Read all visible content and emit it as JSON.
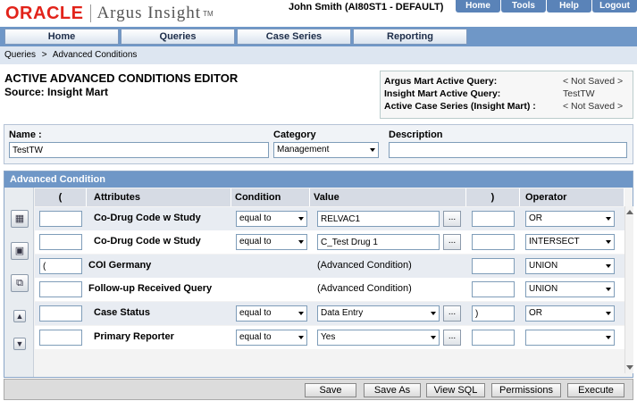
{
  "header": {
    "logo_oracle": "ORACLE",
    "logo_argus": "Argus Insight",
    "logo_tm": "TM",
    "user_info": "John Smith  (AI80ST1 - DEFAULT)",
    "top_links": [
      "Home",
      "Tools",
      "Help",
      "Logout"
    ]
  },
  "main_nav": [
    "Home",
    "Queries",
    "Case Series",
    "Reporting"
  ],
  "breadcrumb": {
    "items": [
      "Queries",
      ">",
      "Advanced Conditions"
    ]
  },
  "page": {
    "title": "ACTIVE ADVANCED CONDITIONS EDITOR",
    "source": "Source: Insight Mart"
  },
  "info": {
    "rows": [
      {
        "key": "Argus Mart Active Query:",
        "value": "< Not Saved >"
      },
      {
        "key": "Insight Mart Active Query:",
        "value": "TestTW"
      },
      {
        "key": "Active Case Series (Insight Mart) :",
        "value": "< Not Saved >"
      }
    ]
  },
  "form": {
    "name_label": "Name :",
    "name_value": "TestTW",
    "category_label": "Category",
    "category_value": "Management",
    "description_label": "Description",
    "description_value": ""
  },
  "advanced": {
    "header": "Advanced Condition",
    "columns": [
      "(",
      "Attributes",
      "Condition",
      "Value",
      ")",
      "Operator"
    ],
    "rows": [
      {
        "open": "",
        "attr": "Co-Drug Code w Study",
        "cond": "equal to",
        "value": "RELVAC1",
        "value_type": "text",
        "close": "",
        "op": "OR"
      },
      {
        "open": "",
        "attr": "Co-Drug Code w Study",
        "cond": "equal to",
        "value": "C_Test Drug 1",
        "value_type": "text",
        "close": "",
        "op": "INTERSECT"
      },
      {
        "open": "(",
        "attr": "COI Germany",
        "cond": "",
        "value": "(Advanced Condition)",
        "value_type": "static",
        "close": "",
        "op": "UNION"
      },
      {
        "open": "",
        "attr": "Follow-up Received Query",
        "cond": "",
        "value": "(Advanced Condition)",
        "value_type": "static",
        "close": "",
        "op": "UNION"
      },
      {
        "open": "",
        "attr": "Case Status",
        "cond": "equal to",
        "value": "Data Entry",
        "value_type": "select",
        "close": ")",
        "op": "OR"
      },
      {
        "open": "",
        "attr": "Primary Reporter",
        "cond": "equal to",
        "value": "Yes",
        "value_type": "select",
        "close": "",
        "op": ""
      }
    ],
    "ellipsis": "..."
  },
  "footer": {
    "buttons": [
      "Save",
      "Save As",
      "View SQL",
      "Permissions",
      "Execute"
    ]
  }
}
